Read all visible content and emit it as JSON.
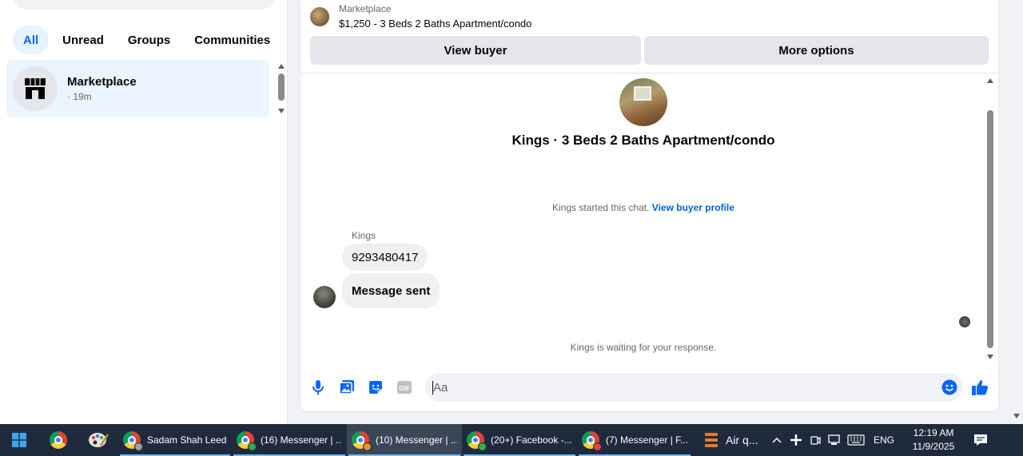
{
  "sidebar": {
    "filters": [
      "All",
      "Unread",
      "Groups",
      "Communities"
    ],
    "active_filter": "All",
    "conversation": {
      "name": "Marketplace",
      "time": "· 19m"
    }
  },
  "chat": {
    "listing_label": "Marketplace",
    "listing_title": "$1,250 - 3 Beds 2 Baths Apartment/condo",
    "view_buyer_label": "View buyer",
    "more_options_label": "More options",
    "hero_title": "Kings · 3 Beds 2 Baths Apartment/condo",
    "started_text": "Kings started this chat.",
    "view_profile_link": "View buyer profile",
    "sender_name": "Kings",
    "messages": [
      "9293480417",
      "Message sent"
    ],
    "waiting_text": "Kings is waiting for your response.",
    "composer_placeholder": "Aa",
    "composer_value": ""
  },
  "taskbar": {
    "apps": [
      {
        "label": "Sadam Shah Leed...",
        "active": false
      },
      {
        "label": "(16) Messenger | ...",
        "active": false
      },
      {
        "label": "(10) Messenger | ...",
        "active": true
      },
      {
        "label": "(20+) Facebook -...",
        "active": false
      },
      {
        "label": "(7) Messenger | F...",
        "active": false
      }
    ],
    "weather_label": "Air q...",
    "language": "ENG",
    "time": "12:19 AM",
    "date": "11/9/2025"
  },
  "colors": {
    "accent": "#0866ff",
    "active_filter_bg": "#e7f3ff",
    "selected_conv_bg": "#ebf5ff",
    "taskbar_bg": "#1f2a3d",
    "link": "#0064d1"
  }
}
